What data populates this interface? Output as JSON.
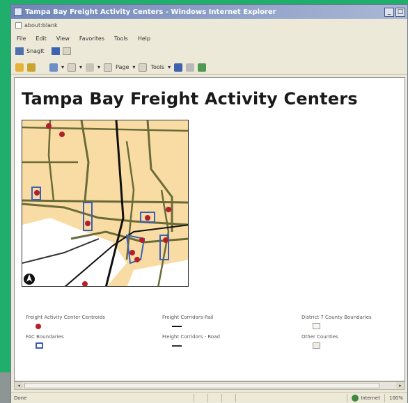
{
  "window": {
    "title": "Tampa Bay Freight Activity Centers - Windows Internet Explorer",
    "address": "about:blank"
  },
  "menu": [
    "File",
    "Edit",
    "View",
    "Favorites",
    "Tools",
    "Help"
  ],
  "links": {
    "snagit_label": "SnagIt"
  },
  "toolbar": {
    "items": [
      "Page",
      "Tools"
    ]
  },
  "page": {
    "title": "Tampa Bay Freight Activity Centers"
  },
  "legend": {
    "freight_centroids": "Freight Activity Center Centroids",
    "fac_boundaries": "FAC Boundaries",
    "corridor_rail": "Freight Corridors-Rail",
    "corridor_road": "Freight Corridors - Road",
    "district7_counties": "District 7 County Boundaries",
    "other_counties": "Other Counties"
  },
  "status": {
    "left": "Done",
    "zone": "Internet",
    "zoom": "100%"
  },
  "colors": {
    "centroid": "#b3202c",
    "boundary": "#3a5fb8",
    "road": "#6b6b3a",
    "land": "#f8dca3"
  }
}
